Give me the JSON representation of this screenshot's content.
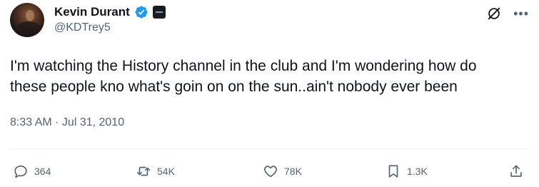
{
  "author": {
    "display_name": "Kevin Durant",
    "handle": "@KDTrey5",
    "verified": true
  },
  "tweet": {
    "text_line1": "I'm watching the History channel in the club and I'm wondering how do",
    "text_line2": "these people kno what's goin on on the sun..ain't nobody ever been",
    "timestamp": "8:33 AM · Jul 31, 2010"
  },
  "actions": {
    "replies": "364",
    "retweets": "54K",
    "likes": "78K",
    "bookmarks": "1.3K"
  },
  "colors": {
    "text": "#0f1419",
    "secondary": "#536471",
    "verified": "#1d9bf0",
    "divider": "#eff3f4"
  },
  "icons": [
    "grok-icon",
    "more-icon",
    "verified-badge-icon",
    "affiliate-badge-icon",
    "reply-icon",
    "retweet-icon",
    "like-icon",
    "bookmark-icon",
    "share-icon"
  ]
}
